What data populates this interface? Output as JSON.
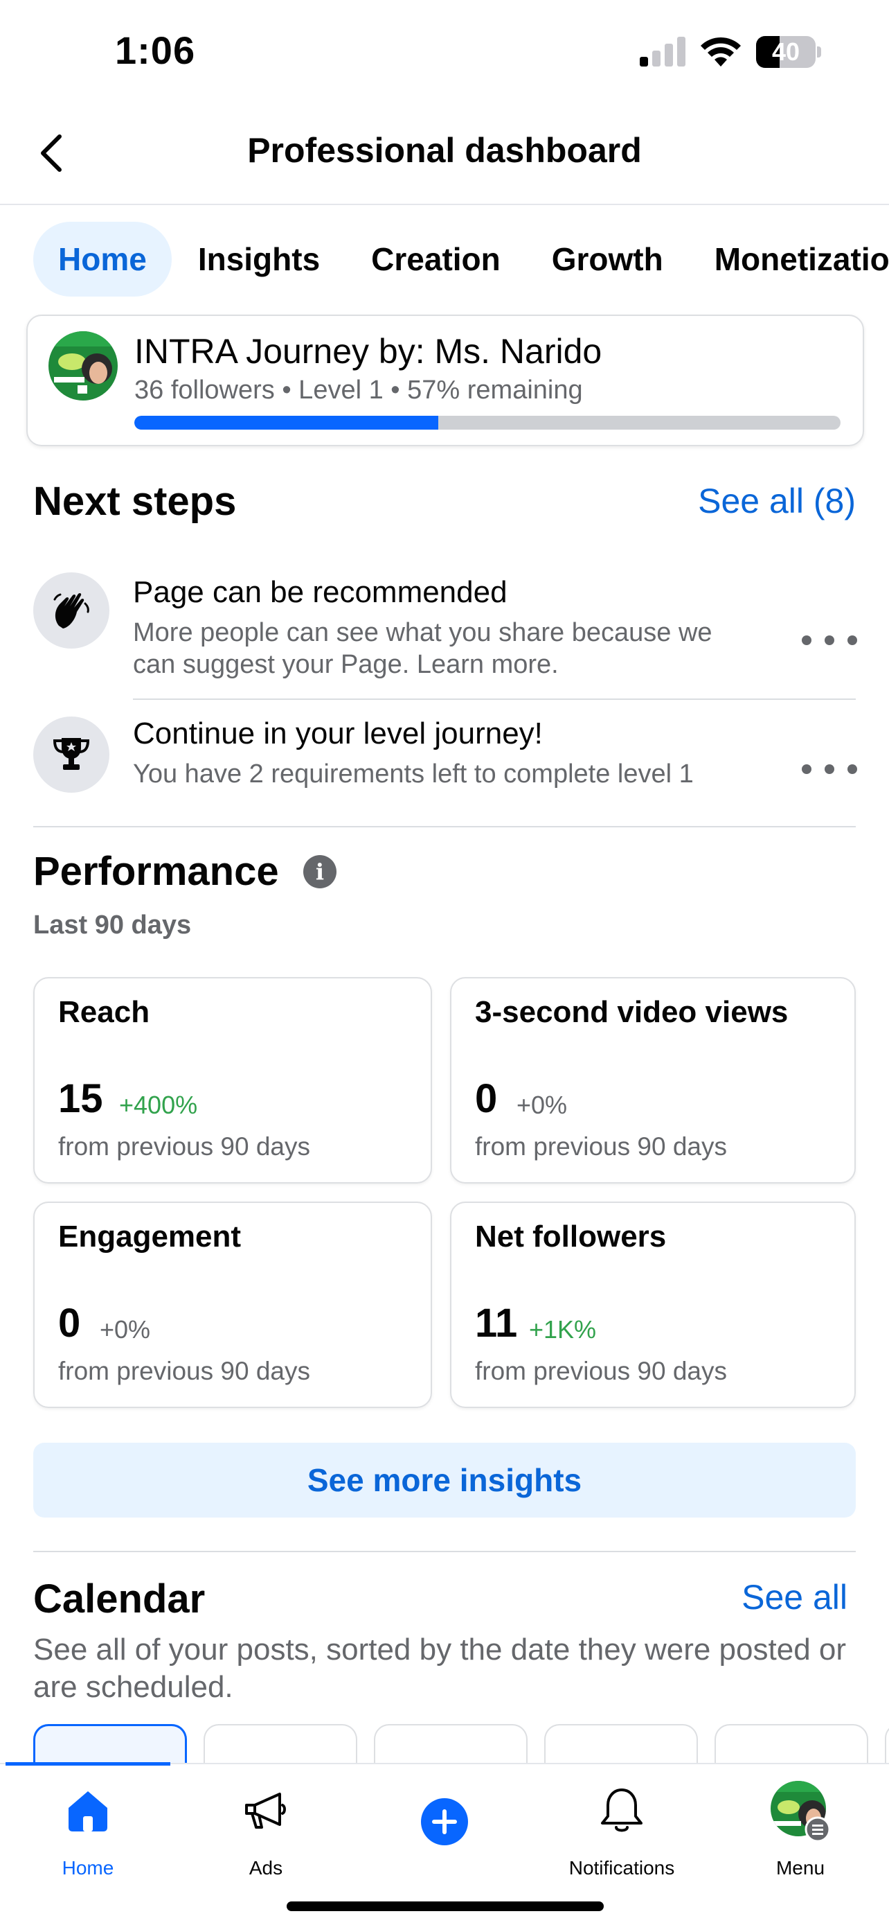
{
  "status_bar": {
    "time": "1:06",
    "battery_level": "40",
    "battery_fraction": 0.4
  },
  "header": {
    "title": "Professional dashboard"
  },
  "tabs": [
    {
      "label": "Home",
      "active": true
    },
    {
      "label": "Insights",
      "active": false
    },
    {
      "label": "Creation",
      "active": false
    },
    {
      "label": "Growth",
      "active": false
    },
    {
      "label": "Monetization",
      "active": false
    }
  ],
  "profile": {
    "name": "INTRA Journey by: Ms. Narido",
    "meta": "36 followers • Level 1 • 57% remaining",
    "progress_fraction": 0.43
  },
  "next_steps": {
    "title": "Next steps",
    "see_all": "See all (8)",
    "items": [
      {
        "icon": "waving-hands-icon",
        "title": "Page can be recommended",
        "desc": "More people can see what you share because we can suggest your Page. Learn more."
      },
      {
        "icon": "trophy-icon",
        "title": "Continue in your level journey!",
        "desc": "You have 2 requirements left to complete level 1"
      }
    ]
  },
  "performance": {
    "title": "Performance",
    "period": "Last 90 days",
    "metrics": [
      {
        "label": "Reach",
        "value": "15",
        "change": "+400%",
        "trend": "pos",
        "foot": "from previous 90 days"
      },
      {
        "label": "3-second video views",
        "value": "0",
        "change": "+0%",
        "trend": "neutral",
        "foot": "from previous 90 days"
      },
      {
        "label": "Engagement",
        "value": "0",
        "change": "+0%",
        "trend": "neutral",
        "foot": "from previous 90 days"
      },
      {
        "label": "Net followers",
        "value": "11",
        "change": "+1K%",
        "trend": "pos",
        "foot": "from previous 90 days"
      }
    ],
    "see_more": "See more insights"
  },
  "calendar": {
    "title": "Calendar",
    "see_all": "See all",
    "desc": "See all of your posts, sorted by the date they were posted or are scheduled."
  },
  "bottom_nav": [
    {
      "label": "Home",
      "icon": "home-icon",
      "active": true
    },
    {
      "label": "Ads",
      "icon": "megaphone-icon",
      "active": false
    },
    {
      "label": "",
      "icon": "create-plus-icon",
      "active": false
    },
    {
      "label": "Notifications",
      "icon": "bell-icon",
      "active": false
    },
    {
      "label": "Menu",
      "icon": "profile-avatar-icon",
      "active": false
    }
  ],
  "colors": {
    "accent": "#0866ff",
    "link": "#0a66d8",
    "positive": "#31a24c",
    "secondary_text": "#65676b"
  }
}
